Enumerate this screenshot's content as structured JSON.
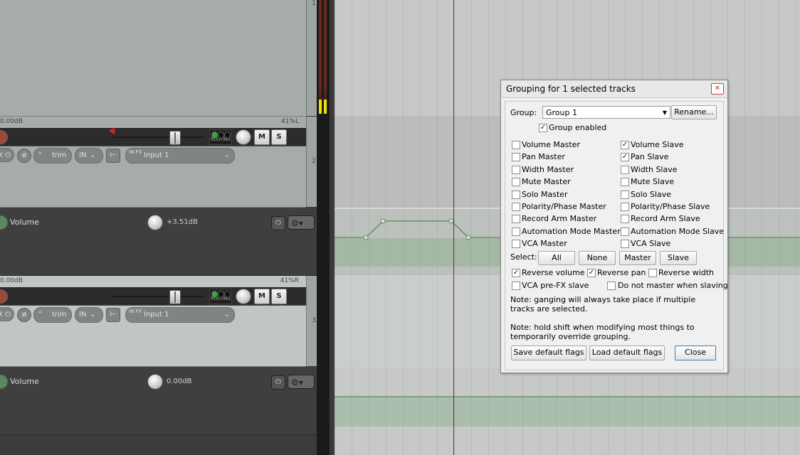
{
  "tracks": [
    {
      "number": "2",
      "db": "0.00dB",
      "pan": "41%L",
      "trim_label": "trim",
      "in_label": "IN",
      "input_label": "Input 1",
      "routing_label": "ROUTING",
      "mute_label": "M",
      "solo_label": "S",
      "fx_label": "IN FX",
      "envelope": {
        "name": "Volume",
        "value": "+3.51dB"
      }
    },
    {
      "number": "3",
      "db": "0.00dB",
      "pan": "41%R",
      "trim_label": "trim",
      "in_label": "IN",
      "input_label": "Input 1",
      "routing_label": "ROUTING",
      "mute_label": "M",
      "solo_label": "S",
      "fx_label": "IN FX",
      "envelope": {
        "name": "Volume",
        "value": "0.00dB"
      }
    }
  ],
  "top_track_number": "1",
  "dialog": {
    "title": "Grouping for 1 selected tracks",
    "close_x": "✕",
    "group_label": "Group:",
    "group_value": "Group 1",
    "rename_button": "Rename...",
    "group_enabled": {
      "label": "Group enabled",
      "checked": true
    },
    "left_checks": [
      {
        "label": "Volume Master",
        "checked": false
      },
      {
        "label": "Pan Master",
        "checked": false
      },
      {
        "label": "Width Master",
        "checked": false
      },
      {
        "label": "Mute Master",
        "checked": false
      },
      {
        "label": "Solo Master",
        "checked": false
      },
      {
        "label": "Polarity/Phase Master",
        "checked": false
      },
      {
        "label": "Record Arm Master",
        "checked": false
      },
      {
        "label": "Automation Mode Master",
        "checked": false
      },
      {
        "label": "VCA Master",
        "checked": false
      }
    ],
    "right_checks": [
      {
        "label": "Volume Slave",
        "checked": true
      },
      {
        "label": "Pan Slave",
        "checked": true
      },
      {
        "label": "Width Slave",
        "checked": false
      },
      {
        "label": "Mute Slave",
        "checked": false
      },
      {
        "label": "Solo Slave",
        "checked": false
      },
      {
        "label": "Polarity/Phase Slave",
        "checked": false
      },
      {
        "label": "Record Arm Slave",
        "checked": false
      },
      {
        "label": "Automation Mode Slave",
        "checked": false
      },
      {
        "label": "VCA Slave",
        "checked": false
      }
    ],
    "select_label": "Select:",
    "select_buttons": {
      "all": "All",
      "none": "None",
      "master": "Master",
      "slave": "Slave"
    },
    "reverse_volume": {
      "label": "Reverse volume",
      "checked": true
    },
    "reverse_pan": {
      "label": "Reverse pan",
      "checked": true
    },
    "reverse_width": {
      "label": "Reverse width",
      "checked": false
    },
    "vca_prefx": {
      "label": "VCA pre-FX slave",
      "checked": false
    },
    "do_not_master": {
      "label": "Do not master when slaving",
      "checked": false
    },
    "note1": "Note: ganging will always take place if multiple tracks are selected.",
    "note2": "Note: hold shift when modifying most things to temporarily override grouping.",
    "save_defaults": "Save default flags",
    "load_defaults": "Load default flags",
    "close_button": "Close"
  },
  "colors": {
    "accent_green": "#5a8a5a",
    "cursor": "#8a2a2a",
    "meter_yellow": "#f0e000"
  }
}
